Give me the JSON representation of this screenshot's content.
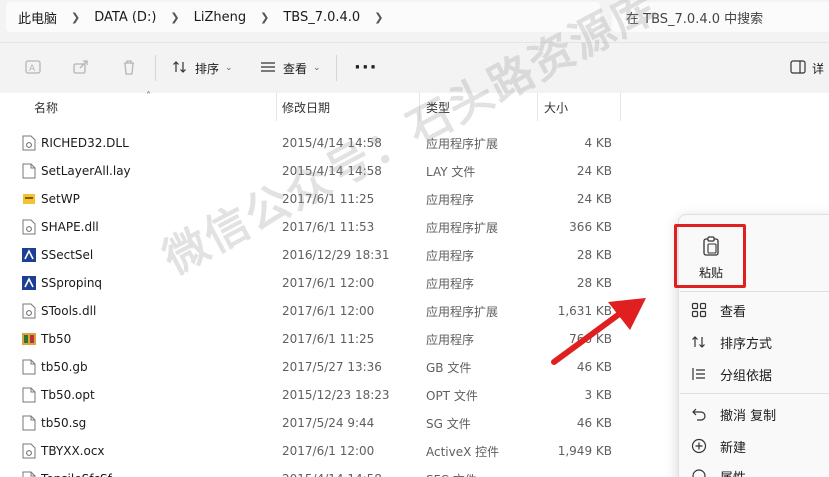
{
  "address": {
    "crumbs": [
      "此电脑",
      "DATA (D:)",
      "LiZheng",
      "TBS_7.0.4.0"
    ]
  },
  "search": {
    "placeholder": "在 TBS_7.0.4.0 中搜索"
  },
  "toolbar": {
    "sort_label": "排序",
    "view_label": "查看",
    "more_label": "···",
    "details_label": "详"
  },
  "columns": {
    "name": "名称",
    "date": "修改日期",
    "type": "类型",
    "size": "大小"
  },
  "files": [
    {
      "name": "RICHED32.DLL",
      "date": "2015/4/14 14:58",
      "type": "应用程序扩展",
      "size": "4 KB",
      "icon": "dll-icon"
    },
    {
      "name": "SetLayerAll.lay",
      "date": "2015/4/14 14:58",
      "type": "LAY 文件",
      "size": "24 KB",
      "icon": "file-icon"
    },
    {
      "name": "SetWP",
      "date": "2017/6/1 11:25",
      "type": "应用程序",
      "size": "24 KB",
      "icon": "app-icon-yellow"
    },
    {
      "name": "SHAPE.dll",
      "date": "2017/6/1 11:53",
      "type": "应用程序扩展",
      "size": "366 KB",
      "icon": "dll-icon"
    },
    {
      "name": "SSectSel",
      "date": "2016/12/29 18:31",
      "type": "应用程序",
      "size": "28 KB",
      "icon": "app-icon-blue"
    },
    {
      "name": "SSpropinq",
      "date": "2017/6/1 12:00",
      "type": "应用程序",
      "size": "28 KB",
      "icon": "app-icon-blue"
    },
    {
      "name": "STools.dll",
      "date": "2017/6/1 12:00",
      "type": "应用程序扩展",
      "size": "1,631 KB",
      "icon": "dll-icon"
    },
    {
      "name": "Tb50",
      "date": "2017/6/1 11:25",
      "type": "应用程序",
      "size": "760 KB",
      "icon": "app-icon-tb"
    },
    {
      "name": "tb50.gb",
      "date": "2017/5/27 13:36",
      "type": "GB 文件",
      "size": "46 KB",
      "icon": "file-icon"
    },
    {
      "name": "Tb50.opt",
      "date": "2015/12/23 18:23",
      "type": "OPT 文件",
      "size": "3 KB",
      "icon": "file-icon"
    },
    {
      "name": "tb50.sg",
      "date": "2017/5/24 9:44",
      "type": "SG 文件",
      "size": "46 KB",
      "icon": "file-icon"
    },
    {
      "name": "TBYXX.ocx",
      "date": "2017/6/1 12:00",
      "type": "ActiveX 控件",
      "size": "1,949 KB",
      "icon": "dll-icon"
    },
    {
      "name": "TensileSfcSf...",
      "date": "2015/4/14 14:58",
      "type": "SFC 文件",
      "size": "",
      "icon": "file-icon"
    }
  ],
  "context_menu": {
    "paste_label": "粘贴",
    "items": [
      {
        "label": "查看",
        "icon": "grid-icon"
      },
      {
        "label": "排序方式",
        "icon": "sort-icon"
      },
      {
        "label": "分组依据",
        "icon": "group-icon"
      },
      {
        "label": "撤消 复制",
        "icon": "undo-icon"
      },
      {
        "label": "新建",
        "icon": "plus-circle-icon"
      },
      {
        "label": "属性",
        "icon": "properties-icon"
      }
    ]
  },
  "watermark": "微信公众号：石头路资源库",
  "colors": {
    "highlight": "#e02020",
    "arrow": "#e02020"
  }
}
